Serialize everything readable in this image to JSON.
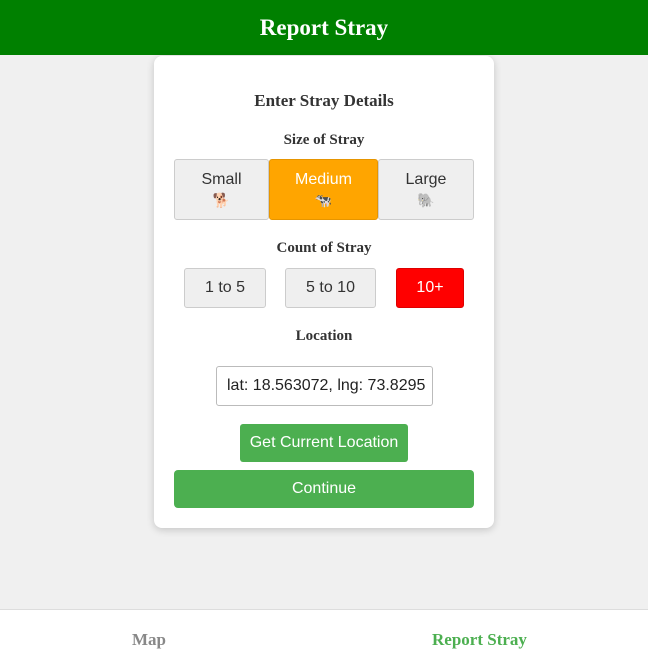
{
  "header": {
    "title": "Report Stray"
  },
  "form": {
    "title": "Enter Stray Details",
    "size": {
      "label": "Size of Stray",
      "selected": "Medium",
      "options": [
        {
          "label": "Small",
          "icon": "🐕"
        },
        {
          "label": "Medium",
          "icon": "🐄"
        },
        {
          "label": "Large",
          "icon": "🐘"
        }
      ]
    },
    "count": {
      "label": "Count of Stray",
      "selected": "10+",
      "options": [
        "1 to 5",
        "5 to 10",
        "10+"
      ]
    },
    "location": {
      "label": "Location",
      "value": "lat: 18.563072, lng: 73.8295",
      "button_label": "Get Current Location"
    },
    "continue_label": "Continue"
  },
  "bottom_nav": {
    "items": [
      {
        "label": "Map",
        "active": false
      },
      {
        "label": "Report Stray",
        "active": true
      }
    ]
  },
  "colors": {
    "header": "#008000",
    "selected_size": "#ffa500",
    "selected_count": "#ff0000",
    "primary_button": "#4caf50",
    "active_nav": "#4caf50"
  }
}
